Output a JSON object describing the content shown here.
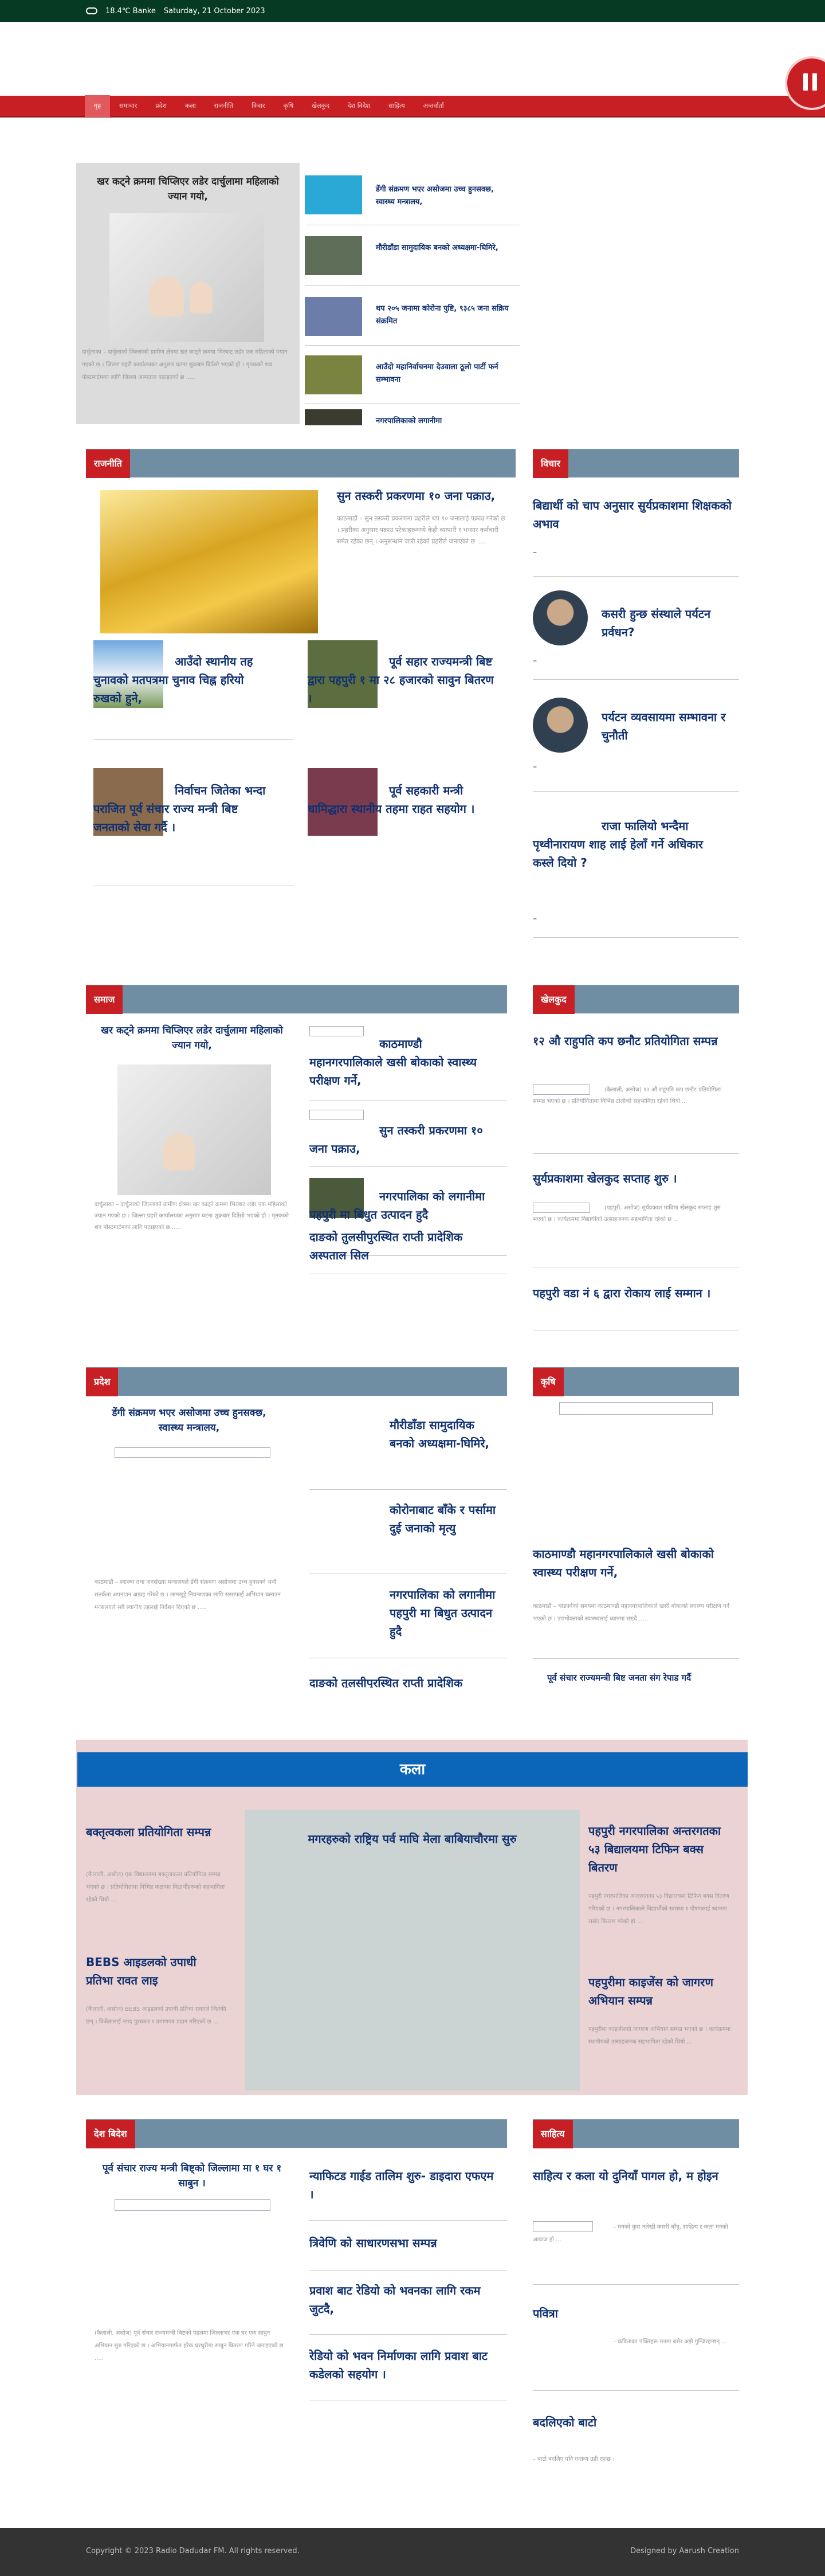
{
  "topbar": {
    "weather": "18.4℃ Banke",
    "date": "Saturday, 21 October 2023"
  },
  "nav": {
    "items": [
      "गृह",
      "समाचार",
      "प्रदेश",
      "कला",
      "राजनीति",
      "विचार",
      "कृषि",
      "खेलकुद",
      "देश विदेश",
      "साहित्य",
      "अन्तर्वार्ता"
    ]
  },
  "hero": {
    "title": "खर कट्नेे क्रममा चिप्लिएर लडेर दार्चुलामा महिलाको ज्यान गयो,",
    "excerpt": "दार्चुलाका – दार्चुलाको जिल्लाको ग्रामीण क्षेत्रमा खर काट्ने क्रममा भिरबाट लडेर एक महिलाको ज्यान गएको छ । जिल्ला प्रहरी कार्यालयका अनुसार घटना शुक्रबार दिउँसो भएको हो । मृतकको शव पोस्टमार्टमका लागि जिल्ला अस्पताल पठाइएको छ ....."
  },
  "latest": [
    "डेंगी संक्रमण भएर असोजमा उच्च हुनसक्छ, स्वास्थ्य मन्त्रालय,",
    "मौरीडाँडा सामुदायिक बनको अध्यक्षमा-घिमिरे,",
    "थप २०५ जनामा कोरोना पुष्टि, ९३८५ जना सक्रिय संक्रमित",
    "आउँदो महानिर्वाचनमा देउवाला ठूलो पार्टी फर्न सम्भावना",
    "नगरपालिकाको लगानीमा"
  ],
  "rajniti": {
    "label": "राजनीति",
    "main_title": "सुन तस्करी प्रकरणमा १० जना पक्राउ,",
    "main_excerpt": "काठमाडौं – सुन तस्करी प्रकरणमा प्रहरीले थप १० जनालाई पक्राउ गरेको छ । प्रहरीका अनुसार पक्राउ परेकाहरूमध्ये केही व्यापारी र भन्सार कर्मचारी समेत रहेका छन् । अनुसन्धान जारी रहेको प्रहरीले जनाएको छ .....",
    "grid": [
      "आउँदो स्थानीय तह चुनावको मतपत्रमा चुनाव चिह्न हरियो रुखको हुने,",
      "पूर्व सहार राज्यमन्त्री बिष्ट द्वारा पहपुरी १ मा २८ हजारको सावुन बितरण ।",
      "निर्वाचन जितेका भन्दा पराजित पूर्व संचार राज्य मन्त्री बिष्ट जनताको सेवा गर्दै ।",
      "पूर्व सहकारी मन्त्री धामिद्धारा स्थानीय तहमा राहत सहयोग ।"
    ]
  },
  "bichar": {
    "label": "विचार",
    "items": [
      {
        "title": "बिद्यार्थी को चाप अनुसार सुर्यप्रकाशमा शिक्षकको अभाव",
        "dash": "–"
      },
      {
        "title": "कसरी हुन्छ संस्थाले पर्यटन प्रर्वधन?",
        "dash": "–"
      },
      {
        "title": "पर्यटन व्यवसायमा सम्भावना र चुनौती",
        "dash": "–"
      },
      {
        "title": "राजा फालियो भन्दैमा पृथ्वीनारायण शाह लाई हेलाँ गर्ने अधिकार कस्ले दियो ?",
        "dash": "–"
      }
    ]
  },
  "samaj": {
    "label": "समाज",
    "main_title": "खर कट्नेे क्रममा चिप्लिएर लडेर दार्चुलामा महिलाको ज्यान गयो,",
    "main_excerpt": "दार्चुलाका – दार्चुलाको जिल्लाको ग्रामीण क्षेत्रमा खर काट्ने क्रममा भिरबाट लडेर एक महिलाको ज्यान गएको छ । जिल्ला प्रहरी कार्यालयका अनुसार घटना शुक्रबार दिउँसो भएको हो । मृतकको शव पोस्टमार्टमका लागि पठाइएको छ .....",
    "list": [
      "काठमाण्डौ महानगरपालिकाले खसी बोकाको स्वास्थ्य परीक्षण गर्ने,",
      "सुन तस्करी प्रकरणमा १० जना पक्राउ,",
      "नगरपालिका को लगानीमा पहपुरी मा बिधुत उत्पादन हुदै",
      "दाङको तुलसीपुरस्थित राप्ती प्रादेशिक अस्पताल सिल"
    ]
  },
  "khelkud": {
    "label": "खेलकुद",
    "items": [
      {
        "title": "१२ औ राहुपति कप छनौट प्रतियोगिता सम्पन्न",
        "excerpt": "(कैलाली, असोज) १२ औं राहुपति कप छनौट प्रतियोगिता सम्पन्न भएको छ । प्रतियोगितामा विभिन्न टोलीको सहभागिता रहेको थियो ..."
      },
      {
        "title": "सुर्यप्रकाशमा खेलकुद सप्ताह शुरु ।",
        "excerpt": "(पहपुरी, असोज) सुर्यप्रकाश माविमा खेलकुद सप्ताह शुरु भएको छ । कार्यक्रममा विद्यार्थीको उत्साहजनक सहभागिता रहेको छ ..."
      },
      {
        "title": "पहपुरी वडा नं ६ द्वारा रोकाय लाई सम्मान ।",
        "excerpt": ""
      }
    ]
  },
  "pradesh": {
    "label": "प्रदेश",
    "main_title": "डेंगी संक्रमण भएर असोजमा उच्च हुनसक्छ, स्वास्थ्य मन्त्रालय,",
    "main_excerpt": "काठमाडौं – स्वास्थ्य तथा जनसंख्या मन्त्रालयले डेंगी संक्रमण असोजमा उच्च हुनसक्ने भन्दै सतर्कता अपनाउन आग्रह गरेको छ । लामखुट्टे नियन्त्रणका लागि सरसफाई अभियान चलाउन मन्त्रालयले सबै स्थानीय तहलाई निर्देशन दिएको छ .....",
    "list": [
      "मौरीडाँडा सामुदायिक बनको अध्यक्षमा-घिमिरे,",
      "कोरोनाबाट बाँके र पर्सामा दुई जनाको मृत्यु",
      "नगरपालिका को लगानीमा पहपुरी मा बिधुत उत्पादन हुदै",
      "दाङको तुलसीपुरस्थित राप्ती प्रादेशिक"
    ]
  },
  "krishi": {
    "label": "कृषि",
    "main_title": "काठमाण्डौ महानगरपालिकाले खसी बोकाको स्वास्थ्य परीक्षण गर्ने,",
    "main_excerpt": "काठमाडौं – चाडपर्वको समयमा काठमाण्डौ महानगरपालिकाले खसी बोकाको स्वास्थ्य परीक्षण गर्ने भएको छ । उपभोक्ताको स्वास्थ्यलाई ध्यानमा राख्दै .....",
    "sub": "पूर्व संचार राज्यमन्त्री बिष्ट जनता संग रेपाड गर्दै"
  },
  "kala": {
    "header": "कला",
    "center_title": "मगरहरुको राष्ट्रिय पर्व माघि मेला बाबियाचौरमा सुरु",
    "left": [
      {
        "title": "बक्तृत्वकला प्रतियोगिता सम्पन्न",
        "excerpt": "(कैलाली, असोज) एक विद्यालयमा बक्तृत्वकला प्रतियोगिता सम्पन्न भएको छ । प्रतियोगितामा विभिन्न कक्षाका विद्यार्थीहरूको सहभागिता रहेको थियो ..."
      },
      {
        "title": "BEBS आइडलको उपाधी प्रतिभा रावत लाइ",
        "excerpt": "(कैलाली, असोज) BEBS आइडलको उपाधी प्रतिभा रावतले जितेकी छन् । विजेतालाई नगद पुरस्कार र प्रमाणपत्र प्रदान गरिएको छ ..."
      }
    ],
    "right": [
      {
        "title": "पहपुरी नगरपालिका अन्तरगतका ५३ बिद्यालयमा टिफिन बक्स बितरण",
        "excerpt": "पहपुरी नगरपालिका अन्तरगतका ५३ विद्यालयमा टिफिन बक्स वितरण गरिएको छ । नगरपालिकाले विद्यार्थीको स्वास्थ्य र पोषणलाई ध्यानमा राखेर वितरण गरेको हो ..."
      },
      {
        "title": "पहपुरीमा काइजेंस को जागरण अभियान सम्पन्न",
        "excerpt": "पहपुरीमा काइजेंसको जागरण अभियान सम्पन्न भएको छ । कार्यक्रममा स्थानीयको उत्साहजनक सहभागिता रहेको थियो ..."
      }
    ]
  },
  "deshbidesh": {
    "label": "देश बिदेश",
    "main_title": "पूर्व संचार राज्य मन्त्री बिष्ट्को जिल्लामा मा १ घर १ साबुन ।",
    "main_excerpt": "(कैलाली, असोज) पूर्व संचार राज्यमन्त्री बिष्टको पहलमा जिल्लाभर एक घर एक साबुन अभियान सुरु गरिएको छ । अभियानमार्फत हरेक घरधुरीमा साबुन वितरण गरिने जनाइएको छ .....",
    "list": [
      "न्याफिटड गाईड तालिम शुरु- डाइदारा एफएम ।",
      "त्रिवेणि को साधारणसभा सम्पन्न",
      "प्रवाश बाट रेडियो को भवनका लागि रकम जुटदै,",
      "रेडियो को भवन निर्माणका लागि प्रवाश बाट कडेलको सहयोग ।"
    ]
  },
  "sahitya": {
    "label": "साहित्य",
    "items": [
      {
        "title": "साहित्य र कला यो दुनियाँ पागल हो, म हाेइन",
        "excerpt": "– मनको कुरा नलेखी कसरी बाँचु, साहित्य र कला मनको आवाज हो ..."
      },
      {
        "title": "पवित्रा",
        "excerpt": "– कविताका पंक्तिहरू मनमा बसेर अझै गुन्जिरहन्छन् ..."
      },
      {
        "title": "बदलिएको बाटो",
        "excerpt": "– बाटो बदलिए पनि गन्तव्य उही रहन्छ ।"
      }
    ]
  },
  "footer": {
    "copyright": "Copyright © 2023 Radio Dadudar FM. All rights reserved.",
    "designed_by": "Designed by Aarush Creation"
  },
  "colors": {
    "brand_red": "#c81f24",
    "nav_red": "#c81f24",
    "heading_blue": "#103070",
    "section_bar": "#6f8ea4",
    "kala_blue": "#0b65b8",
    "kala_bg": "#ecd3d3"
  }
}
